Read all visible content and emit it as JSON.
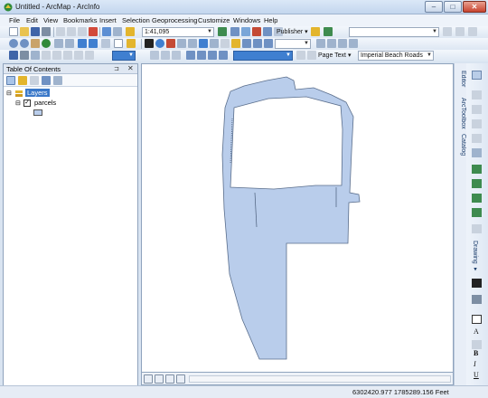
{
  "window": {
    "title": "Untitled - ArcMap - ArcInfo",
    "buttons": {
      "minimize": "–",
      "maximize": "□",
      "close": "✕"
    }
  },
  "menu": [
    "File",
    "Edit",
    "View",
    "Bookmarks",
    "Insert",
    "Selection",
    "Geoprocessing",
    "Customize",
    "Windows",
    "Help"
  ],
  "toolbar": {
    "scale": "1:41,095",
    "publisher_label": "Publisher ▾",
    "page_text_label": "Page Text ▾",
    "font_combo": "Imperial Beach Roads"
  },
  "toc": {
    "title": "Table Of Contents",
    "pin": "⊐ ✕",
    "close": "✕",
    "layers_label": "Layers",
    "layer_name": "parcels"
  },
  "right_dock": {
    "tabs": [
      "Editor",
      "ArcToolbox",
      "Catalog"
    ],
    "drawing_label": "Drawing ▾"
  },
  "status": {
    "coords": "6302420.977  1785289.156 Feet"
  },
  "colors": {
    "parcel_fill": "#b9cdeb",
    "parcel_stroke": "#5a6e8c",
    "layers_highlight": "#3a78c9"
  }
}
